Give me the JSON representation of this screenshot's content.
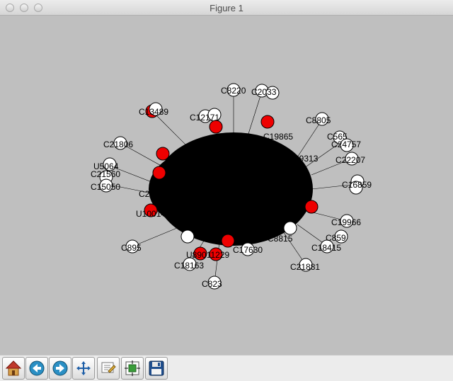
{
  "window": {
    "title": "Figure 1",
    "colors": {
      "canvas_bg": "#bfbfbf",
      "node_white": "#ffffff",
      "node_red": "#ee0000",
      "edges": "#000000"
    }
  },
  "graph": {
    "labels": [
      "C8220",
      "C2033",
      "C13489",
      "C12171",
      "C21806",
      "U5064",
      "C21560",
      "C15050",
      "C16859",
      "C21605",
      "U10014",
      "C18163",
      "C823",
      "C895",
      "U89011229",
      "C17630",
      "C8815",
      "C21881",
      "C18415",
      "C859",
      "C19966",
      "C8805",
      "C24757",
      "C565",
      "C22207",
      "C9313",
      "C19865"
    ]
  },
  "toolbar": {
    "buttons": [
      {
        "name": "home-button",
        "icon": "home-icon"
      },
      {
        "name": "back-button",
        "icon": "back-arrow-icon"
      },
      {
        "name": "forward-button",
        "icon": "forward-arrow-icon"
      },
      {
        "name": "pan-button",
        "icon": "move-icon"
      },
      {
        "name": "zoom-button",
        "icon": "zoom-rect-icon"
      },
      {
        "name": "subplots-button",
        "icon": "subplots-icon"
      },
      {
        "name": "save-button",
        "icon": "save-icon"
      }
    ]
  }
}
